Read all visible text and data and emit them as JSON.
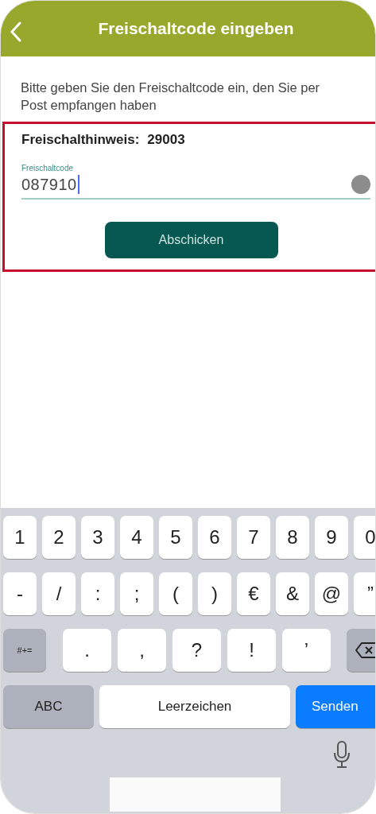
{
  "header": {
    "title": "Freischaltcode eingeben"
  },
  "intro": "Bitte geben Sie den Freischaltcode ein, den Sie per Post empfangen haben",
  "form": {
    "hint_label": "Freischalthinweis:",
    "hint_value": "29003",
    "field": {
      "label": "Freischaltcode",
      "value": "087910"
    },
    "submit": "Abschicken"
  },
  "keyboard": {
    "rows": [
      {
        "keys": [
          {
            "kind": "char",
            "label": "1"
          },
          {
            "kind": "char",
            "label": "2"
          },
          {
            "kind": "char",
            "label": "3"
          },
          {
            "kind": "char",
            "label": "4"
          },
          {
            "kind": "char",
            "label": "5"
          },
          {
            "kind": "char",
            "label": "6"
          },
          {
            "kind": "char",
            "label": "7"
          },
          {
            "kind": "char",
            "label": "8"
          },
          {
            "kind": "char",
            "label": "9"
          },
          {
            "kind": "char",
            "label": "0"
          }
        ]
      },
      {
        "keys": [
          {
            "kind": "char",
            "label": "-"
          },
          {
            "kind": "char",
            "label": "/"
          },
          {
            "kind": "char",
            "label": ":"
          },
          {
            "kind": "char",
            "label": ";"
          },
          {
            "kind": "char",
            "label": "("
          },
          {
            "kind": "char",
            "label": ")"
          },
          {
            "kind": "char",
            "label": "€"
          },
          {
            "kind": "char",
            "label": "&"
          },
          {
            "kind": "char",
            "label": "@"
          },
          {
            "kind": "char",
            "label": "”"
          }
        ]
      },
      {
        "keys": [
          {
            "kind": "mode",
            "label": "#+="
          },
          {
            "kind": "wide",
            "label": "."
          },
          {
            "kind": "wide",
            "label": ","
          },
          {
            "kind": "wide",
            "label": "?"
          },
          {
            "kind": "wide",
            "label": "!"
          },
          {
            "kind": "wide",
            "label": "’"
          },
          {
            "kind": "delete"
          }
        ]
      },
      {
        "keys": [
          {
            "kind": "abc",
            "label": "ABC"
          },
          {
            "kind": "space",
            "label": "Leerzeichen"
          },
          {
            "kind": "send",
            "label": "Senden"
          }
        ]
      }
    ]
  }
}
